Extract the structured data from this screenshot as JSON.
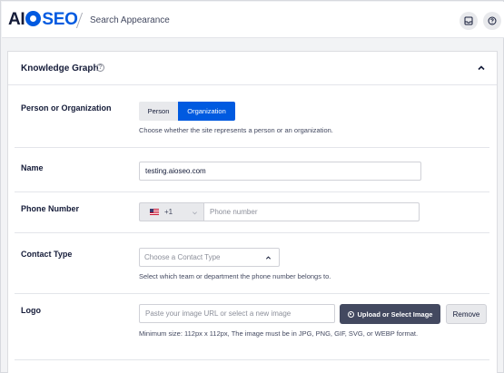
{
  "header": {
    "logo_prefix": "AI",
    "logo_suffix": "SEO",
    "breadcrumb": "Search Appearance",
    "buttons": [
      {
        "icon": "inbox-icon"
      },
      {
        "icon": "help-icon"
      }
    ]
  },
  "card": {
    "title": "Knowledge Graph",
    "help_glyph": "?",
    "collapse_icon": "chevron-up-icon"
  },
  "rows": {
    "entity": {
      "label": "Person or Organization",
      "options": [
        "Person",
        "Organization"
      ],
      "selected": "Organization",
      "hint": "Choose whether the site represents a person or an organization."
    },
    "name": {
      "label": "Name",
      "value": "testing.aioseo.com"
    },
    "phone": {
      "label": "Phone Number",
      "dial_code": "+1",
      "country_flag": "us-flag-icon",
      "placeholder": "Phone number"
    },
    "contact": {
      "label": "Contact Type",
      "placeholder": "Choose a Contact Type",
      "hint": "Select which team or department the phone number belongs to."
    },
    "logo": {
      "label": "Logo",
      "placeholder": "Paste your image URL or select a new image",
      "upload_label": "Upload or Select Image",
      "remove_label": "Remove",
      "hint": "Minimum size: 112px x 112px, The image must be in JPG, PNG, GIF, SVG, or WEBP format."
    }
  },
  "colors": {
    "accent": "#005ae0",
    "dark_button": "#434960",
    "text": "#141b38"
  }
}
